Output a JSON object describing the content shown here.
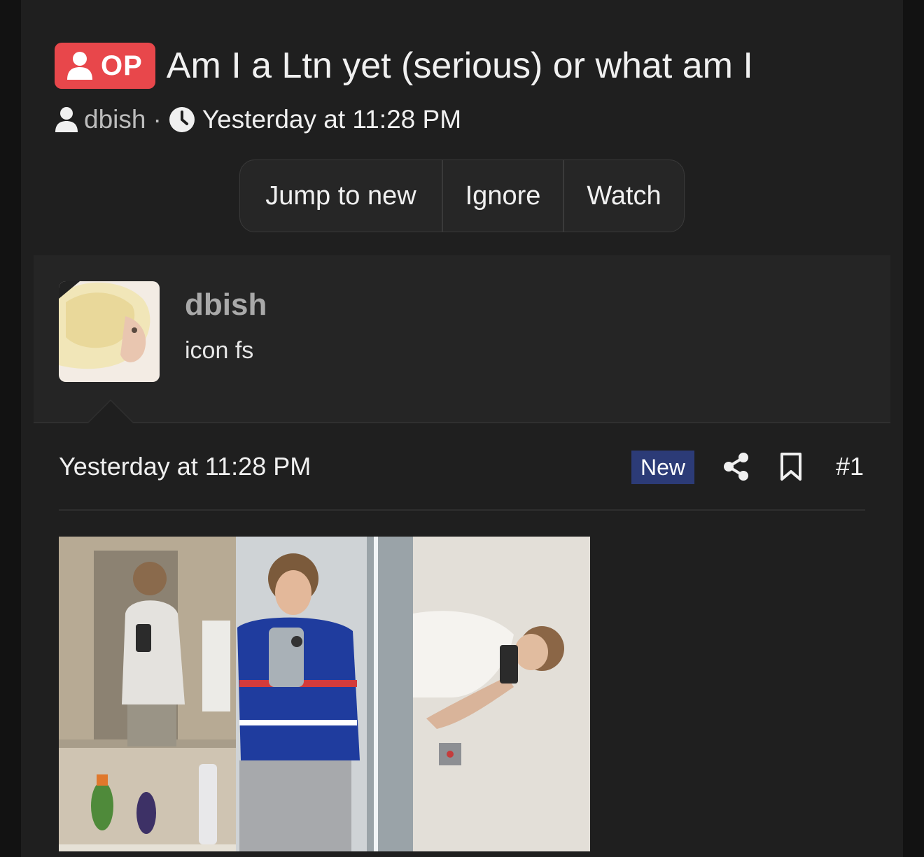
{
  "thread": {
    "op_label": "OP",
    "title": "Am I a Ltn yet (serious) or what am I",
    "author": "dbish",
    "separator": "·",
    "time": "Yesterday at 11:28 PM"
  },
  "actions": {
    "jump": "Jump to new",
    "ignore": "Ignore",
    "watch": "Watch"
  },
  "user": {
    "name": "dbish",
    "title": "icon fs"
  },
  "post": {
    "time": "Yesterday at 11:28 PM",
    "new_label": "New",
    "number": "#1"
  },
  "icons": {
    "op": "user-icon",
    "author": "user-icon",
    "time": "clock-icon",
    "share": "share-icon",
    "bookmark": "bookmark-icon"
  },
  "colors": {
    "op_badge": "#e8474b",
    "new_badge": "#2c3b77",
    "panel": "#1f1f1f",
    "user_block": "#252525"
  }
}
